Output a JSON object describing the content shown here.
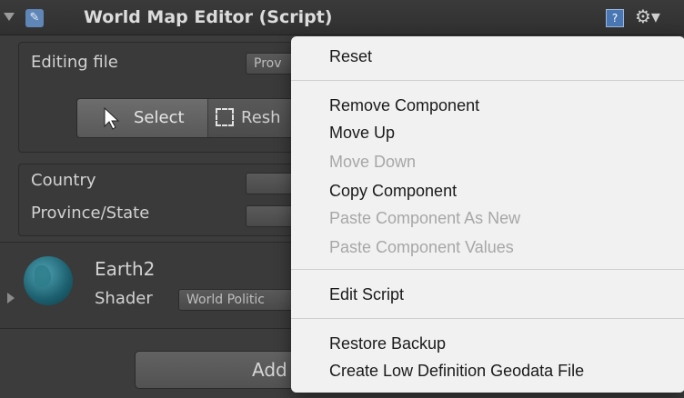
{
  "header": {
    "title": "World Map Editor (Script)",
    "help_icon": "help-icon",
    "gear_icon": "gear-icon",
    "help_glyph": "?",
    "gear_glyph": "⚙▾"
  },
  "editing": {
    "label": "Editing file",
    "value": "Prov"
  },
  "toolbar": {
    "select_label": "Select",
    "reshape_label": "Resh"
  },
  "fields": {
    "country_label": "Country",
    "province_label": "Province/State"
  },
  "earth": {
    "name": "Earth2",
    "shader_label": "Shader",
    "shader_value": "World Politic"
  },
  "add_button": {
    "label": "Add"
  },
  "context_menu": {
    "items": [
      {
        "label": "Reset",
        "enabled": true
      },
      {
        "label": "Remove Component",
        "enabled": true
      },
      {
        "label": "Move Up",
        "enabled": true
      },
      {
        "label": "Move Down",
        "enabled": false
      },
      {
        "label": "Copy Component",
        "enabled": true
      },
      {
        "label": "Paste Component As New",
        "enabled": false
      },
      {
        "label": "Paste Component Values",
        "enabled": false
      },
      {
        "label": "Edit Script",
        "enabled": true
      },
      {
        "label": "Restore Backup",
        "enabled": true
      },
      {
        "label": "Create Low Definition Geodata File",
        "enabled": true
      }
    ]
  }
}
